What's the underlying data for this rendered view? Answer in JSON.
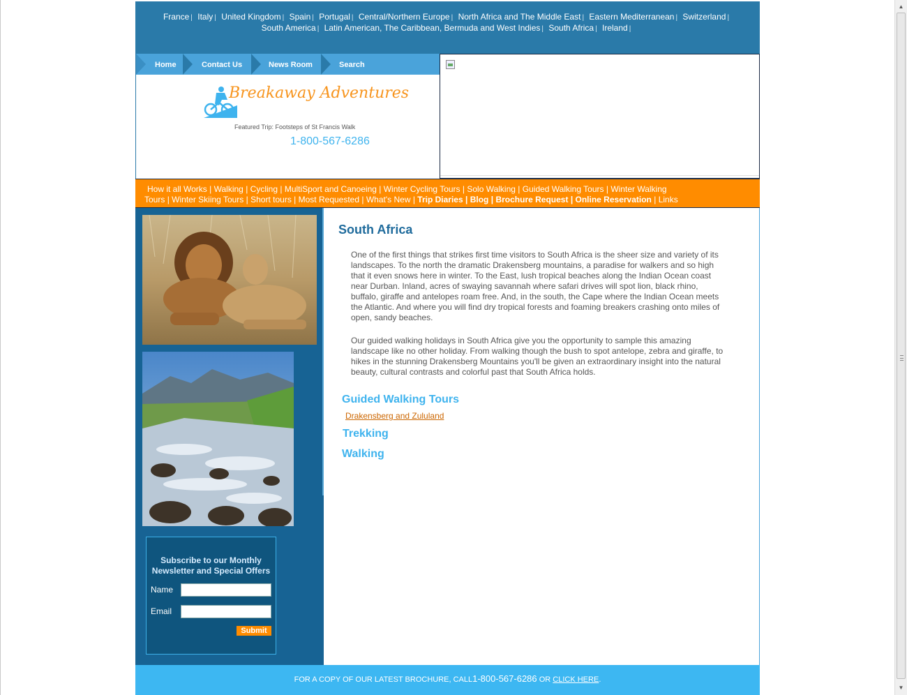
{
  "countries": {
    "row1": [
      "France",
      "Italy",
      "United Kingdom",
      "Spain",
      "Portugal",
      "Central/Northern Europe",
      "North Africa and The Middle East",
      "Eastern Mediterranean",
      "Switzerland"
    ],
    "row2": [
      "South America",
      "Latin American, The Caribbean, Bermuda and West Indies",
      "South Africa",
      "Ireland"
    ],
    "separator": "|"
  },
  "nav": {
    "home": "Home",
    "contact": "Contact Us",
    "news": "News Room",
    "search": "Search"
  },
  "logo": {
    "brand": "Breakaway Adventures",
    "featured": "Featured Trip: Footsteps of St Francis Walk",
    "phone": "1-800-567-6286"
  },
  "menu": {
    "line1": [
      "How it all Works",
      "Walking",
      "Cycling",
      "MultiSport and Canoeing",
      "Winter Cycling Tours",
      "Solo Walking",
      "Guided Walking Tours",
      "Winter Walking"
    ],
    "line2_start": "Tours",
    "line2": [
      "Winter Skiing Tours",
      "Short tours",
      "Most Requested",
      "What's New"
    ],
    "bold": [
      "Trip Diaries",
      "Blog",
      "Brochure Request",
      "Online Reservation"
    ],
    "last": "Links",
    "separator": "|"
  },
  "newsletter": {
    "title": "Subscribe to our Monthly Newsletter and Special Offers",
    "name_label": "Name",
    "email_label": "Email",
    "name_value": "",
    "email_value": "",
    "submit": "Submit"
  },
  "main": {
    "title": "South Africa",
    "p1": "One of the first things that strikes first time visitors to South Africa is the sheer size and variety of its landscapes. To the north the dramatic Drakensberg mountains, a paradise for walkers and so high that it even snows here in winter. To the East, lush tropical beaches along the Indian Ocean coast near Durban. Inland, acres of swaying savannah where safari drives will spot lion, black rhino, buffalo, giraffe and antelopes roam free. And, in the south, the Cape where the Indian Ocean meets the Atlantic. And where you will find dry tropical forests and foaming breakers crashing onto miles of open, sandy beaches.",
    "p2": "Our guided walking holidays in South Africa give you the opportunity to sample this amazing landscape like no other holiday. From walking though the bush to spot antelope, zebra and giraffe, to hikes in the stunning Drakensberg Mountains you'll be given an extraordinary insight into the natural beauty, cultural contrasts and colorful past that South Africa holds.",
    "guided_heading": "Guided Walking Tours",
    "guided_link": "Drakensberg and Zululand",
    "trekking_heading": "Trekking",
    "walking_heading": "Walking"
  },
  "footer": {
    "text1": "FOR A COPY OF OUR LATEST BROCHURE, CALL",
    "phone": "1-800-567-6286",
    "text2": "OR",
    "click": "CLICK HERE",
    "end": "."
  },
  "colors": {
    "top_bar": "#2a7aa9",
    "nav_blue": "#4aa3da",
    "orange": "#ff8c00",
    "sidebar": "#176394",
    "footer": "#3db7f2",
    "heading": "#1f6b9c",
    "subheading": "#3eb3ee",
    "link": "#cc6600"
  }
}
